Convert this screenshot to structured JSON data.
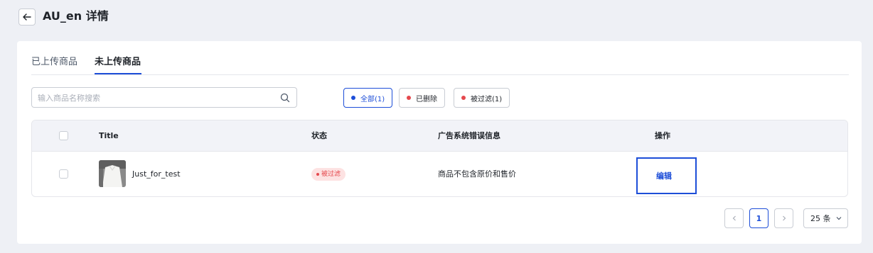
{
  "page": {
    "title": "AU_en 详情"
  },
  "tabs": [
    {
      "label": "已上传商品",
      "active": false
    },
    {
      "label": "未上传商品",
      "active": true
    }
  ],
  "search": {
    "placeholder": "输入商品名称搜索",
    "value": ""
  },
  "filters": [
    {
      "label": "全部(1)",
      "dot_color": "#1d4ed8",
      "active": true
    },
    {
      "label": "已删除",
      "dot_color": "#e5484d",
      "active": false
    },
    {
      "label": "被过滤(1)",
      "dot_color": "#e5484d",
      "active": false
    }
  ],
  "table": {
    "columns": [
      "Title",
      "状态",
      "广告系统错误信息",
      "操作"
    ],
    "rows": [
      {
        "title": "Just_for_test",
        "status": "被过滤",
        "error": "商品不包含原价和售价",
        "action": "编辑"
      }
    ]
  },
  "pagination": {
    "current_page": "1",
    "page_size": "25 条"
  },
  "colors": {
    "accent": "#1d4ed8",
    "danger": "#e5484d",
    "background": "#eef0f5"
  }
}
